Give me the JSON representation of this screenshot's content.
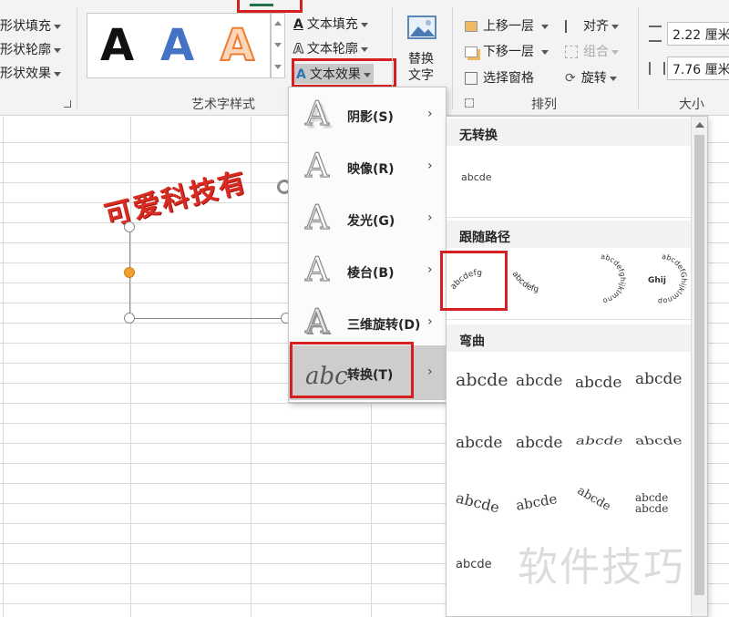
{
  "ribbon": {
    "shape_fill": "形状填充",
    "shape_outline": "形状轮廓",
    "shape_effects": "形状效果",
    "text_fill": "文本填充",
    "text_outline": "文本轮廓",
    "text_effects": "文本效果",
    "replace_text_line1": "替换",
    "replace_text_line2": "文字",
    "bring_forward": "上移一层",
    "send_backward": "下移一层",
    "selection_pane": "选择窗格",
    "align": "对齐",
    "group": "组合",
    "rotate": "旋转",
    "height_value": "2.22 厘米",
    "width_value": "7.76 厘米",
    "groups": {
      "wordart_styles": "艺术字样式",
      "arrange": "排列",
      "size": "大小"
    },
    "style_letters": [
      "A",
      "A",
      "A"
    ],
    "style_colors": [
      "#111111",
      "#4472c4",
      "#ed7d31"
    ]
  },
  "sheet": {
    "art_text": "可爱科技有"
  },
  "effects_menu": {
    "items": [
      {
        "label": "阴影(S)",
        "icon": "shadow-A-icon"
      },
      {
        "label": "映像(R)",
        "icon": "reflection-A-icon"
      },
      {
        "label": "发光(G)",
        "icon": "glow-A-icon"
      },
      {
        "label": "棱台(B)",
        "icon": "bevel-A-icon"
      },
      {
        "label": "三维旋转(D)",
        "icon": "rotation-3d-A-icon"
      },
      {
        "label": "转换(T)",
        "icon": "transform-abc-icon"
      }
    ],
    "transform_icon_text": "abc"
  },
  "gallery": {
    "no_transform": "无转换",
    "follow_path": "跟随路径",
    "warp": "弯曲",
    "sample_text": "abcde",
    "path_samples": [
      "abcdefg",
      "abcdefg",
      "abcdefghijklmno",
      "abcdefGhijklmnop"
    ],
    "circle_inner_text": "Ghij"
  },
  "watermark": "软件技巧",
  "colors": {
    "highlight_red": "#d42020",
    "art_text_red": "#d92b20",
    "selection_orange": "#f0a030"
  }
}
